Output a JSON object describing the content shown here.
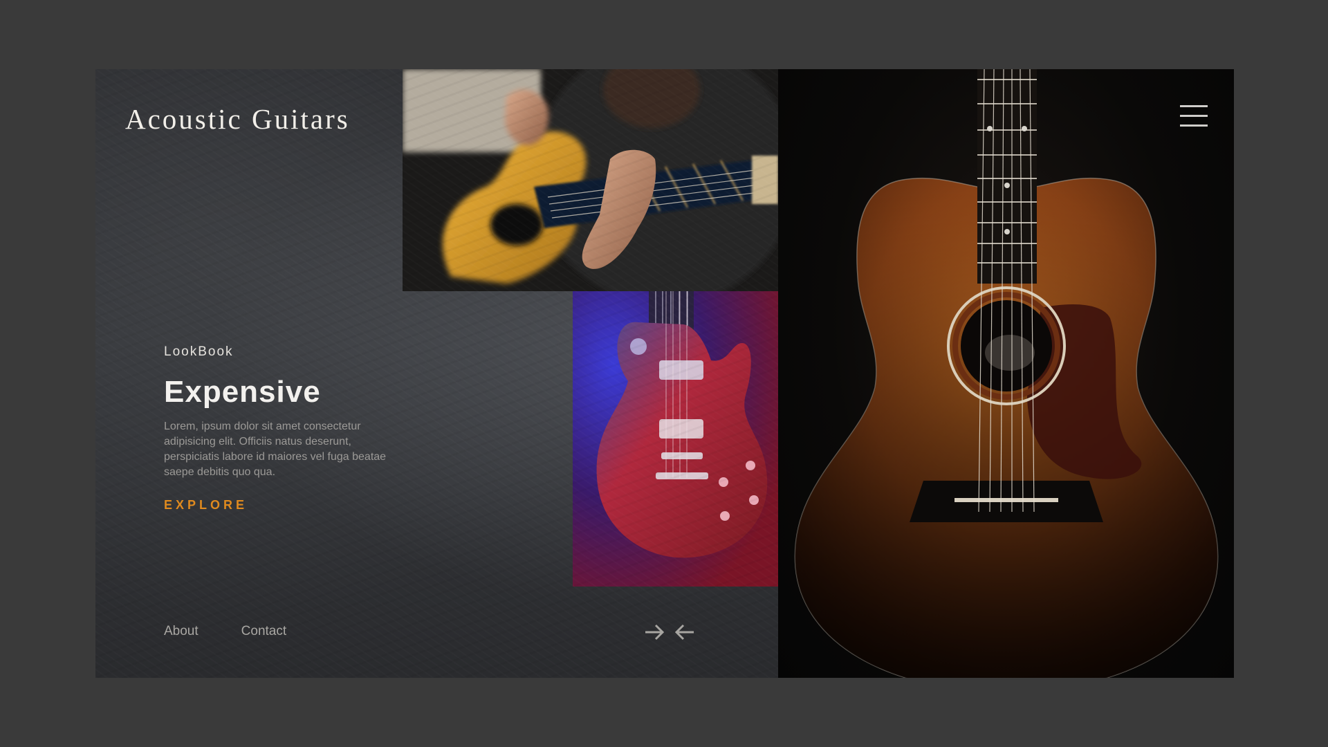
{
  "brand": {
    "title": "Acoustic Guitars"
  },
  "hero": {
    "eyebrow": "LookBook",
    "headline": "Expensive",
    "blurb": "Lorem, ipsum dolor sit amet consectetur adipisicing elit. Officiis natus deserunt, perspiciatis labore id maiores vel fuga beatae saepe debitis quo qua.",
    "cta_label": "EXPLORE"
  },
  "footer": {
    "links": [
      {
        "label": "About"
      },
      {
        "label": "Contact"
      }
    ]
  },
  "icons": {
    "next": "arrow-right-icon",
    "prev": "arrow-left-icon",
    "menu": "hamburger-menu-icon"
  },
  "colors": {
    "accent": "#e08a1e",
    "background": "#3a3a3a",
    "panel": "#2e2f32",
    "text_primary": "#f3f1ee",
    "text_muted": "#9c9a97"
  }
}
